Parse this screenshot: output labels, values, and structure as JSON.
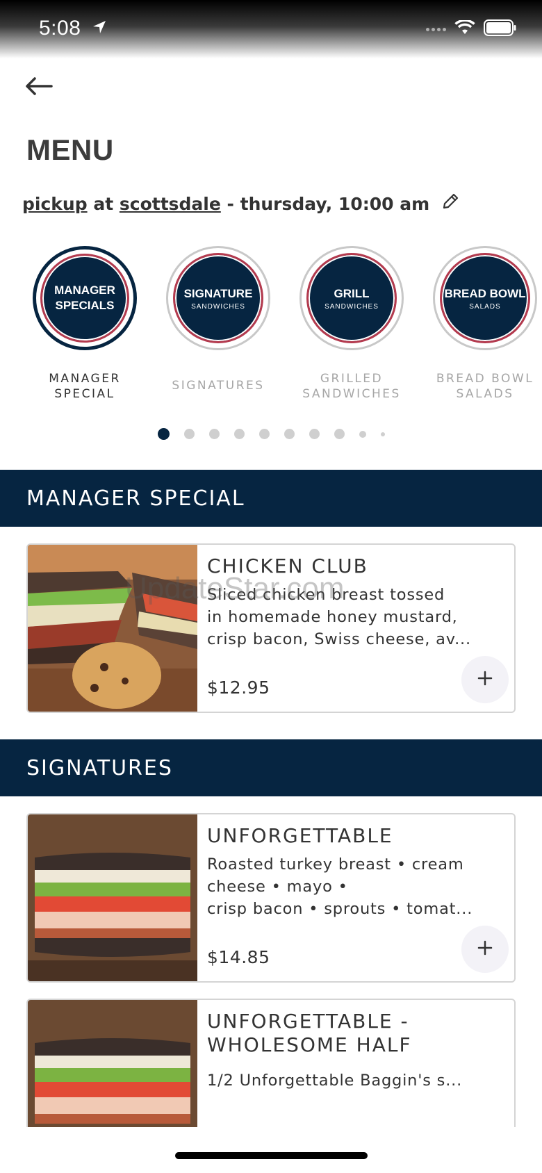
{
  "status_bar": {
    "time": "5:08"
  },
  "header": {
    "title": "MENU"
  },
  "order": {
    "mode": "pickup",
    "at": "at",
    "location": "scottsdale",
    "when": "- thursday, 10:00 am"
  },
  "categories": [
    {
      "disc_big": "MANAGER\nSPECIALS",
      "disc_small": "",
      "label": "MANAGER\nSPECIAL",
      "active": true
    },
    {
      "disc_big": "SIGNATURE",
      "disc_small": "SANDWICHES",
      "label": "SIGNATURES",
      "active": false
    },
    {
      "disc_big": "GRILL",
      "disc_small": "SANDWICHES",
      "label": "GRILLED\nSANDWICHES",
      "active": false
    },
    {
      "disc_big": "BREAD BOWL",
      "disc_small": "SALADS",
      "label": "BREAD BOWL\nSALADS",
      "active": false
    }
  ],
  "pagination": {
    "total": 10,
    "active_index": 0
  },
  "sections": [
    {
      "title": "MANAGER SPECIAL",
      "items": [
        {
          "name": "CHICKEN CLUB",
          "desc": [
            "Sliced chicken breast tossed",
            "in homemade honey mustard,",
            "crisp bacon, Swiss cheese, av..."
          ],
          "price": "$12.95"
        }
      ]
    },
    {
      "title": "SIGNATURES",
      "items": [
        {
          "name": "UNFORGETTABLE",
          "desc": [
            "Roasted turkey breast • cream",
            "cheese • mayo •",
            "crisp bacon • sprouts • tomat..."
          ],
          "price": "$14.85"
        },
        {
          "name": "UNFORGETTABLE -\nWHOLESOME HALF",
          "desc": [
            "1/2 Unforgettable Baggin's s..."
          ],
          "price": ""
        }
      ]
    }
  ],
  "watermark": "UpdateStar.com",
  "colors": {
    "navy": "#062541",
    "accent_red": "#b43a4e",
    "inactive_text": "#a6a6a6"
  }
}
